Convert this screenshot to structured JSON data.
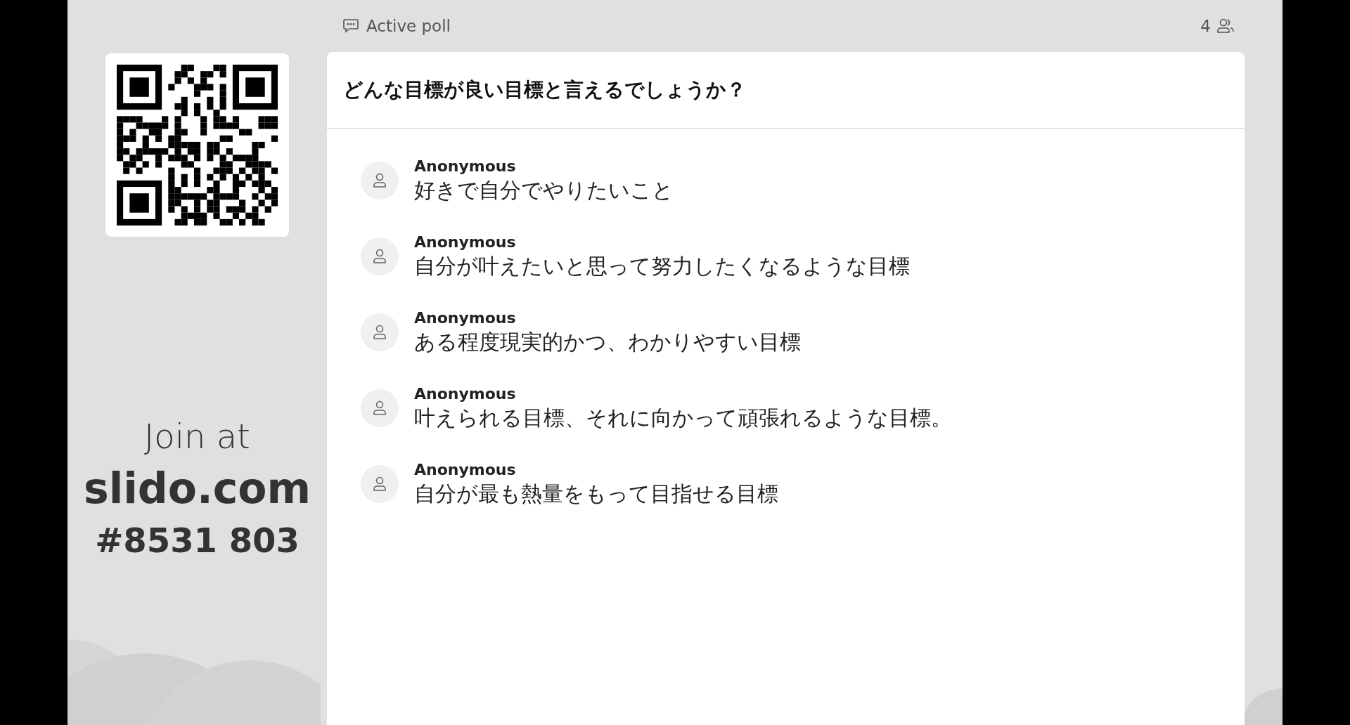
{
  "header": {
    "label": "Active poll",
    "participants": "4"
  },
  "join": {
    "prefix": "Join at",
    "site": "slido.com",
    "code": "#8531 803"
  },
  "poll": {
    "question": "どんな目標が良い目標と言えるでしょうか？",
    "answers": [
      {
        "author": "Anonymous",
        "text": "好きで自分でやりたいこと"
      },
      {
        "author": "Anonymous",
        "text": "自分が叶えたいと思って努力したくなるような目標"
      },
      {
        "author": "Anonymous",
        "text": "ある程度現実的かつ、わかりやすい目標"
      },
      {
        "author": "Anonymous",
        "text": "叶えられる目標、それに向かって頑張れるような目標。"
      },
      {
        "author": "Anonymous",
        "text": "自分が最も熱量をもって目指せる目標"
      }
    ]
  }
}
